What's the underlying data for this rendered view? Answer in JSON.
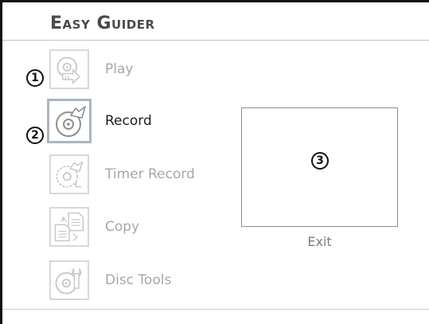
{
  "app": {
    "title": "Easy Guider"
  },
  "menu": {
    "items": [
      {
        "label": "Play",
        "icon": "disc-play-icon",
        "selected": false
      },
      {
        "label": "Record",
        "icon": "disc-record-icon",
        "selected": true
      },
      {
        "label": "Timer Record",
        "icon": "disc-timer-record-icon",
        "selected": false
      },
      {
        "label": "Copy",
        "icon": "copy-documents-icon",
        "selected": false
      },
      {
        "label": "Disc Tools",
        "icon": "disc-tools-icon",
        "selected": false
      }
    ]
  },
  "preview": {
    "exit_label": "Exit"
  },
  "callouts": [
    "1",
    "2",
    "3"
  ],
  "colors": {
    "selected_border": "#a9b5c2",
    "inactive_text": "#a7a7a7",
    "active_text": "#1e1e1e"
  }
}
